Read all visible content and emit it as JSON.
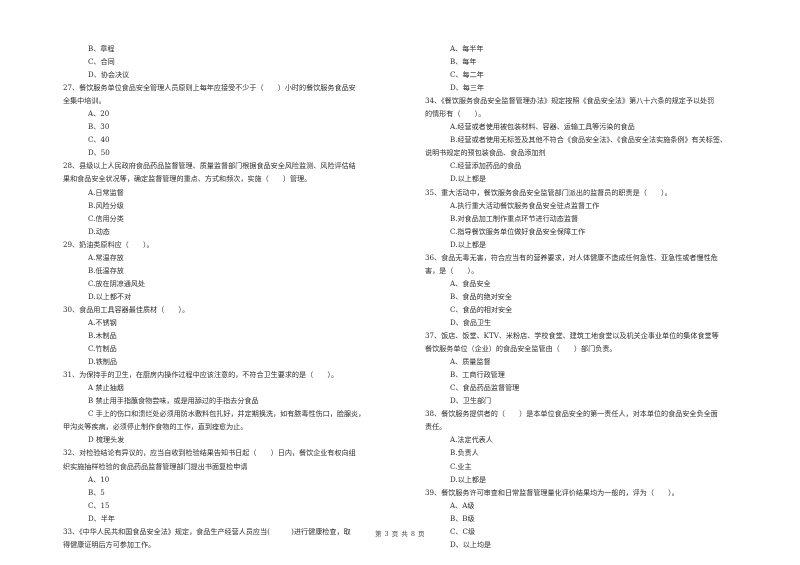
{
  "left_column": {
    "leading_options": [
      "B、章程",
      "C、合同",
      "D、协会决议"
    ],
    "questions": [
      {
        "number": "27",
        "lines": [
          "27、餐饮服务单位食品安全管理人员原则上每年应接受不少于（　　）小时的餐饮服务食品安",
          "全集中培训。"
        ],
        "options": [
          "A、20",
          "B、30",
          "C、40",
          "D、50"
        ]
      },
      {
        "number": "28",
        "lines": [
          "28、县级以上人民政府食品药品监督管理、质量监督部门根据食品安全风险监测、风险评估结",
          "果和食品安全状况等，确定监督管理的重点、方式和频次，实施（　　）管理。"
        ],
        "options": [
          "A.日常监督",
          "B.风险分级",
          "C.信用分类",
          "D.动态"
        ]
      },
      {
        "number": "29",
        "lines": [
          "29、奶油类原料应（　　）。"
        ],
        "options": [
          "A.常温存放",
          "B.低温存放",
          "C.放在阴凉通风处",
          "D.以上都不对"
        ]
      },
      {
        "number": "30",
        "lines": [
          "30、食品用工具容器最佳质材（　　）。"
        ],
        "options": [
          "A.不锈钢",
          "B.木制品",
          "C.竹制品",
          "D.铁制品"
        ]
      },
      {
        "number": "31",
        "lines": [
          "31、为保持手的卫生，在厨房内操作过程中应该注意的，不符合卫生要求的是（　　）。"
        ],
        "options": [
          "A  禁止抽烟",
          "B  禁止用手指蘸食物尝味，或是用舔过的手指去分食品",
          "C  手上的伤口和溃烂处必须用防水敷料包扎好，并定期换洗，如有脓毒性伤口，脸腺炎，",
          "D  梳理头发"
        ],
        "option_c_continuation": "甲沟炎等疾病，必须停止制作食物的工作，直到痊愈为止。"
      },
      {
        "number": "32",
        "lines": [
          "32、对检验结论有异议的，应当自收到检验结果告知书日起（　　）日内，餐饮企业有权向组",
          "织实施抽样检验的食品药品监督管理部门提出书面复检申请"
        ],
        "options": [
          "A、10",
          "B、5",
          "C、15",
          "D、半年"
        ]
      },
      {
        "number": "33",
        "lines": [
          "33、《中华人民共和国食品安全法》规定，食品生产经营人员应当(　　　)进行健康检查，取",
          "得健康证明后方可参加工作。"
        ],
        "options": []
      }
    ]
  },
  "right_column": {
    "leading_options": [
      "A、每半年",
      "B、每年",
      "C、每二年",
      "D、每三年"
    ],
    "questions": [
      {
        "number": "34",
        "lines": [
          "34、《餐饮服务食品安全监督管理办法》规定按照《食品安全法》第八十六条的规定予以处罚",
          "的情形有（　　）。"
        ],
        "options": [
          "A.经营或者使用被包装材料、容器、运输工具等污染的食品",
          "B.经营或者使用无标签及其他不符合《食品安全法》、《食品安全法实施条例》有关标签、",
          "C.经营添加药品的食品",
          "D.以上都是"
        ],
        "option_b_continuation": "说明书规定的预包装食品、食品添加剂"
      },
      {
        "number": "35",
        "lines": [
          "35、重大活动中，餐饮服务食品安全监管部门派出的监督员的职责是（　　）。"
        ],
        "options": [
          "A.执行重大活动餐饮服务食品安全驻点监督工作",
          "B.对食品加工制作重点环节进行动态监督",
          "C.指导餐饮服务单位做好食品安全保障工作",
          "D.以上都是"
        ]
      },
      {
        "number": "36",
        "lines": [
          "36、食品无毒无害，符合应当有的营养要求，对人体健康不造成任何急性、亚急性或者慢性危",
          "害，是（　　）。"
        ],
        "options": [
          "A、食品安全",
          "B、食品的绝对安全",
          "C、食品的相对安全",
          "D、食品卫生"
        ]
      },
      {
        "number": "37",
        "lines": [
          "37、饭店、饭堂、KTV、米粉店、学校食堂、建筑工地食堂以及机关企事业单位的集体食堂等",
          "餐饮服务单位（企业）的食品安全监管由（　　）部门负责。"
        ],
        "options": [
          "A、质量监督",
          "B、工商行政管理",
          "C、食品药品监督管理",
          "D、卫生部门"
        ]
      },
      {
        "number": "38",
        "lines": [
          "38、餐饮服务提供者的（　　）是本单位食品安全的第一责任人，对本单位的食品安全负全面",
          "责任。"
        ],
        "options": [
          "A.法定代表人",
          "B.负责人",
          "C.业主",
          "D.以上都是"
        ]
      },
      {
        "number": "39",
        "lines": [
          "39、餐饮服务许可审查和日常监督管理量化评价结果均为一般的，评为（　　）。"
        ],
        "options": [
          "A、A级",
          "B、B级",
          "C、C级",
          "D、以上均是"
        ]
      }
    ]
  },
  "footer": {
    "page_label": "第 3 页 共 8 页"
  }
}
